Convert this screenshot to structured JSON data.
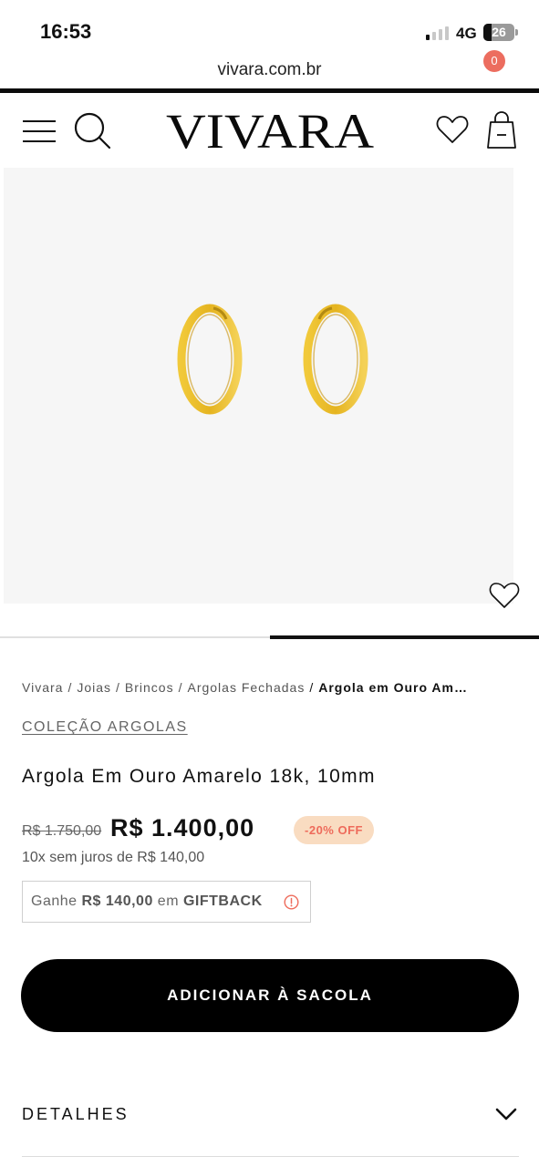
{
  "status_bar": {
    "time": "16:53",
    "network": "4G",
    "battery": "26"
  },
  "browser": {
    "url": "vivara.com.br"
  },
  "header": {
    "logo_text": "VIVARA",
    "bag_count": "0"
  },
  "product_image": {
    "description_icon": "gold-hoop-earrings",
    "carousel_position": 0.5
  },
  "breadcrumb": {
    "items": [
      "Vivara",
      "Joias",
      "Brincos",
      "Argolas Fechadas"
    ],
    "separator": "/",
    "current": "Argola em Ouro Am…"
  },
  "product": {
    "collection": "COLEÇÃO ARGOLAS",
    "title": "Argola Em Ouro Amarelo 18k, 10mm",
    "old_price": "R$ 1.750,00",
    "price": "R$ 1.400,00",
    "discount": "-20% OFF",
    "installments": "10x sem juros de R$ 140,00",
    "giftback": {
      "prefix": "Ganhe",
      "amount": "R$ 140,00",
      "middle": "em",
      "label": "GIFTBACK"
    }
  },
  "actions": {
    "add_to_bag": "ADICIONAR À SACOLA"
  },
  "details": {
    "label": "DETALHES"
  },
  "colors": {
    "accent": "#000000",
    "badge": "#ec6d5f",
    "discount_bg": "#f9dcc1",
    "discount_text": "#ee6b5b",
    "gold": "#e8b92a"
  }
}
